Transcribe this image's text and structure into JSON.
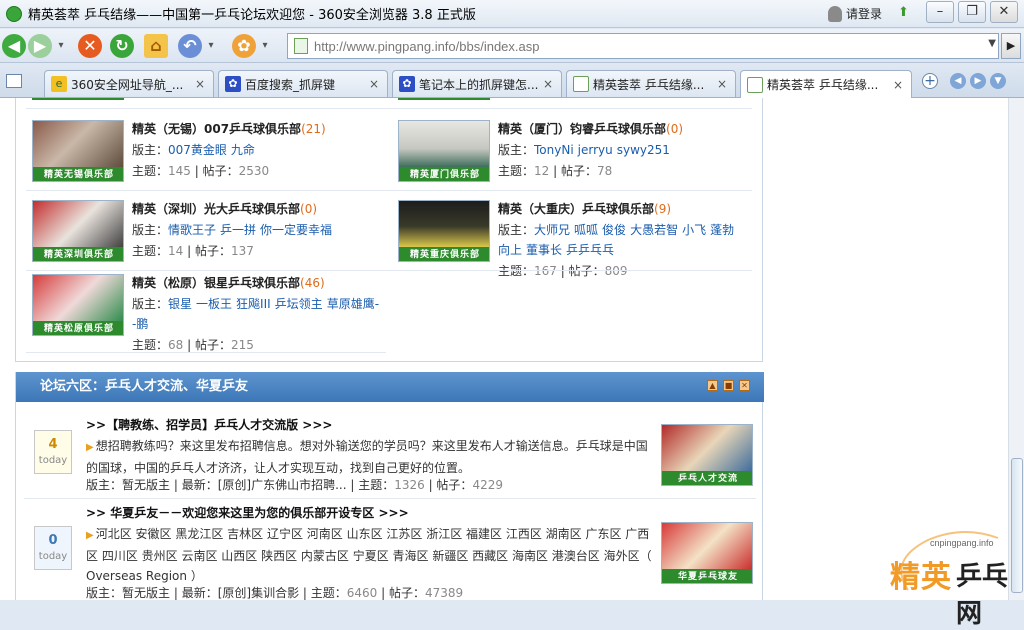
{
  "window": {
    "title": "精英荟萃 乒乓结缘——中国第一乒乓论坛欢迎您 - 360安全浏览器 3.8 正式版",
    "login": "请登录",
    "minimize": "–",
    "maximize": "❐",
    "close": "✕"
  },
  "nav": {
    "url": "http://www.pingpang.info/bbs/index.asp",
    "dropdown": "▼",
    "go": "▶"
  },
  "tabs": [
    {
      "label": "360安全网址导航_...",
      "close": "×"
    },
    {
      "label": "百度搜索_抓屏键",
      "close": "×"
    },
    {
      "label": "笔记本上的抓屏键怎...",
      "close": "×"
    },
    {
      "label": "精英荟萃 乒乓结缘...",
      "close": "×"
    },
    {
      "label": "精英荟萃 乒乓结缘...",
      "close": "×"
    }
  ],
  "clubs": [
    {
      "name": "精英（无锡）007乒乓球俱乐部",
      "count": "(21)",
      "mods_label": "版主：",
      "mods": [
        "007黄金眼",
        "九命"
      ],
      "stats_label": "主题：",
      "topics": "145",
      "posts_label": "| 帖子：",
      "posts": "2530",
      "caption": "精英无锡俱乐部"
    },
    {
      "name": "精英（厦门）钧睿乒乓球俱乐部",
      "count": "(0)",
      "mods_label": "版主：",
      "mods": [
        "TonyNi",
        "jerryu",
        "sywy251"
      ],
      "stats_label": "主题：",
      "topics": "12",
      "posts_label": "| 帖子：",
      "posts": "78",
      "caption": "精英厦门俱乐部"
    },
    {
      "name": "精英（深圳）光大乒乓球俱乐部",
      "count": "(0)",
      "mods_label": "版主：",
      "mods": [
        "情歌王子",
        "乒一拼",
        "你一定要幸福"
      ],
      "stats_label": "主题：",
      "topics": "14",
      "posts_label": "| 帖子：",
      "posts": "137",
      "caption": "精英深圳俱乐部"
    },
    {
      "name": "精英（大重庆）乒乓球俱乐部",
      "count": "(9)",
      "mods_label": "版主：",
      "mods": [
        "大师兄",
        "呱呱",
        "俊俊",
        "大愚若智",
        "小飞",
        "蓬勃",
        "向上",
        "董事长",
        "乒乒乓乓"
      ],
      "stats_label": "主题：",
      "topics": "167",
      "posts_label": "| 帖子：",
      "posts": "809",
      "caption": "精英重庆俱乐部"
    },
    {
      "name": "精英（松原）银星乒乓球俱乐部",
      "count": "(46)",
      "mods_label": "版主：",
      "mods": [
        "银星",
        "一板王",
        "狂飚III",
        "乒坛领主",
        "草原雄鹰--鹏"
      ],
      "stats_label": "主题：",
      "topics": "68",
      "posts_label": "| 帖子：",
      "posts": "215",
      "caption": "精英松原俱乐部"
    }
  ],
  "section6": {
    "title": "论坛六区：乒乓人才交流、华夏乒友",
    "icons": [
      "▲",
      "■",
      "✕"
    ],
    "forums": [
      {
        "badge_num": "4",
        "badge_text": "today",
        "title": ">>【聘教练、招学员】乒乓人才交流版 >>>",
        "desc": "想招聘教练吗？来这里发布招聘信息。想对外输送您的学员吗？来这里发布人才输送信息。乒乓球是中国的国球，中国的乒乓人才济济，让人才实现互动，找到自己更好的位置。",
        "meta_mod": "版主：暂无版主",
        "meta_latest": "| 最新：[原创]广东佛山市招聘...",
        "meta_topics_label": "| 主题：",
        "topics": "1326",
        "meta_posts_label": "| 帖子：",
        "posts": "4229",
        "caption": "乒乓人才交流"
      },
      {
        "badge_num": "0",
        "badge_text": "today",
        "title": ">> 华夏乒友－－欢迎您来这里为您的俱乐部开设专区 >>>",
        "desc": "河北区 安徽区 黑龙江区 吉林区 辽宁区 河南区 山东区 江苏区 浙江区 福建区 江西区 湖南区 广东区 广西区 四川区 贵州区 云南区 山西区 陕西区 内蒙古区 宁夏区 青海区 新疆区 西藏区 海南区 港澳台区 海外区（ Overseas Region ）",
        "meta_mod": "版主：暂无版主",
        "meta_latest": "| 最新：[原创]集训合影",
        "meta_topics_label": "| 主题：",
        "topics": "6460",
        "meta_posts_label": "| 帖子：",
        "posts": "47389",
        "caption": "华夏乒乓球友"
      }
    ]
  },
  "watermark": {
    "site": "cnpingpang.info",
    "text1": "精英",
    "text2": "乒乓网"
  }
}
